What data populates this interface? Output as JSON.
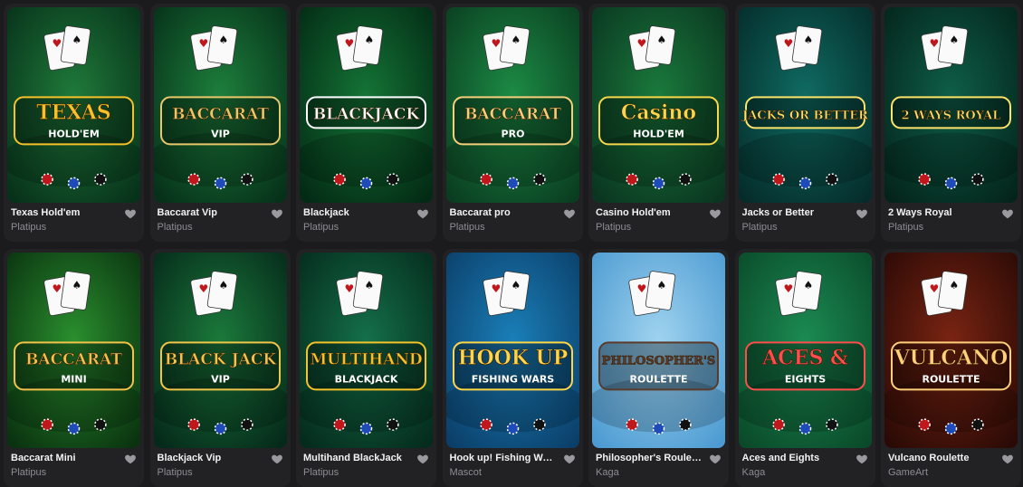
{
  "games": [
    {
      "name": "Texas Hold'em",
      "provider": "Platipus",
      "logo": [
        "TEXAS",
        "HOLD'EM"
      ],
      "logo_color": "#f5c229",
      "bg": "#1f7a3a",
      "bg2": "#07311a",
      "icon": "favorite-heart-icon"
    },
    {
      "name": "Baccarat Vip",
      "provider": "Platipus",
      "logo": [
        "BACCARAT",
        "VIP"
      ],
      "logo_color": "#e9c86a",
      "bg": "#1d7f3c",
      "bg2": "#063019",
      "icon": "favorite-heart-icon"
    },
    {
      "name": "Blackjack",
      "provider": "Platipus",
      "logo": [
        "BLACKJACK",
        ""
      ],
      "logo_color": "#ffffff",
      "bg": "#147436",
      "bg2": "#032a14",
      "icon": "favorite-heart-icon"
    },
    {
      "name": "Baccarat pro",
      "provider": "Platipus",
      "logo": [
        "BACCARAT",
        "PRO"
      ],
      "logo_color": "#f4d07a",
      "bg": "#1c8b45",
      "bg2": "#0a3d20",
      "icon": "favorite-heart-icon"
    },
    {
      "name": "Casino Hold'em",
      "provider": "Platipus",
      "logo": [
        "Casino",
        "HOLD'EM"
      ],
      "logo_color": "#f8d84a",
      "bg": "#1a7a3c",
      "bg2": "#0a3520",
      "icon": "favorite-heart-icon"
    },
    {
      "name": "Jacks or Better",
      "provider": "Platipus",
      "logo": [
        "JACKS OR BETTER",
        ""
      ],
      "logo_color": "#fce36a",
      "bg": "#0f6b62",
      "bg2": "#052c2a",
      "icon": "favorite-heart-icon"
    },
    {
      "name": "2 Ways Royal",
      "provider": "Platipus",
      "logo": [
        "2 WAYS ROYAL",
        ""
      ],
      "logo_color": "#fce36a",
      "bg": "#0e5e48",
      "bg2": "#04241b",
      "icon": "favorite-heart-icon"
    },
    {
      "name": "Baccarat Mini",
      "provider": "Platipus",
      "logo": [
        "BACCARAT",
        "MINI"
      ],
      "logo_color": "#f4c24a",
      "bg": "#2a8f2e",
      "bg2": "#0a3210",
      "icon": "favorite-heart-icon"
    },
    {
      "name": "Blackjack Vip",
      "provider": "Platipus",
      "logo": [
        "BLACK JACK",
        "VIP"
      ],
      "logo_color": "#f1c54a",
      "bg": "#1b7a3b",
      "bg2": "#05291a",
      "icon": "favorite-heart-icon"
    },
    {
      "name": "Multihand BlackJack",
      "provider": "Platipus",
      "logo": [
        "MULTIHAND",
        "BLACKJACK"
      ],
      "logo_color": "#f5c229",
      "bg": "#14704a",
      "bg2": "#052b1c",
      "icon": "favorite-heart-icon"
    },
    {
      "name": "Hook up! Fishing Wars",
      "provider": "Mascot",
      "logo": [
        "HOOK UP",
        "FISHING WARS"
      ],
      "logo_color": "#ffd54a",
      "bg": "#1a7fb8",
      "bg2": "#0b3f6a",
      "icon": "favorite-heart-icon"
    },
    {
      "name": "Philosopher's Roulette",
      "provider": "Kaga",
      "logo": [
        "PHILOSOPHER'S",
        "ROULETTE"
      ],
      "logo_color": "#5b3a2a",
      "bg": "#9fd3ef",
      "bg2": "#4d9bd2",
      "icon": "favorite-heart-icon"
    },
    {
      "name": "Aces and Eights",
      "provider": "Kaga",
      "logo": [
        "ACES &",
        "EIGHTS"
      ],
      "logo_color": "#ff4d4d",
      "bg": "#1b8b52",
      "bg2": "#0a4a2a",
      "icon": "favorite-heart-icon"
    },
    {
      "name": "Vulcano Roulette",
      "provider": "GameArt",
      "logo": [
        "VULCANO",
        "ROULETTE"
      ],
      "logo_color": "#ffcf7a",
      "bg": "#7a2412",
      "bg2": "#2a0a06",
      "icon": "favorite-heart-icon"
    }
  ]
}
